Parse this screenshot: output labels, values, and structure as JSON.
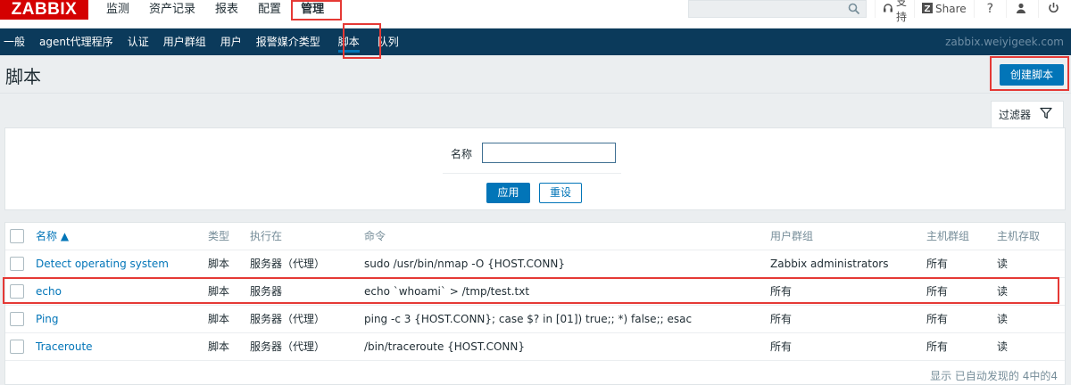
{
  "logo": "ZABBIX",
  "main_menu": [
    {
      "label": "监测"
    },
    {
      "label": "资产记录"
    },
    {
      "label": "报表"
    },
    {
      "label": "配置"
    },
    {
      "label": "管理",
      "active": true
    }
  ],
  "search": {
    "value": "",
    "placeholder": ""
  },
  "top_right": {
    "support": "支持",
    "share": "Share",
    "help": "?"
  },
  "sub_menu": [
    {
      "label": "一般"
    },
    {
      "label": "agent代理程序"
    },
    {
      "label": "认证"
    },
    {
      "label": "用户群组"
    },
    {
      "label": "用户"
    },
    {
      "label": "报警媒介类型"
    },
    {
      "label": "脚本",
      "active": true
    },
    {
      "label": "队列"
    }
  ],
  "host": "zabbix.weiyigeek.com",
  "page_title": "脚本",
  "create_button": "创建脚本",
  "filter": {
    "tab_label": "过滤器",
    "name_label": "名称",
    "name_value": "",
    "apply": "应用",
    "reset": "重设"
  },
  "table": {
    "headers": [
      "名称 ▲",
      "类型",
      "执行在",
      "命令",
      "用户群组",
      "主机群组",
      "主机存取"
    ],
    "rows": [
      [
        "Detect operating system",
        "脚本",
        "服务器（代理）",
        "sudo /usr/bin/nmap -O {HOST.CONN}",
        "Zabbix administrators",
        "所有",
        "读"
      ],
      [
        "echo",
        "脚本",
        "服务器",
        "echo `whoami` > /tmp/test.txt",
        "所有",
        "所有",
        "读"
      ],
      [
        "Ping",
        "脚本",
        "服务器（代理）",
        "ping -c 3 {HOST.CONN}; case $? in [01]) true;; *) false;; esac",
        "所有",
        "所有",
        "读"
      ],
      [
        "Traceroute",
        "脚本",
        "服务器（代理）",
        "/bin/traceroute {HOST.CONN}",
        "所有",
        "所有",
        "读"
      ]
    ],
    "footer": "显示 已自动发现的 4中的4"
  },
  "colors": {
    "brand_red": "#d40000",
    "nav_dark": "#0b3a5b",
    "primary": "#0275b8",
    "highlight": "#e53935"
  }
}
